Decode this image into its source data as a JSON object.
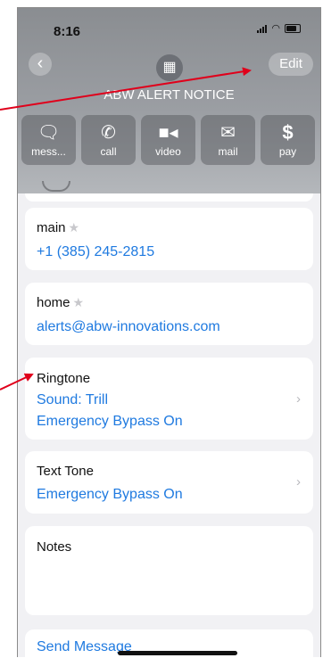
{
  "status_bar": {
    "time": "8:16"
  },
  "header": {
    "back_icon": "chevron-left-icon",
    "edit_label": "Edit",
    "contact_name": "ABW ALERT NOTICE",
    "avatar_icon": "building-icon",
    "actions": [
      {
        "label": "mess...",
        "icon": "message-bubble-icon"
      },
      {
        "label": "call",
        "icon": "phone-icon"
      },
      {
        "label": "video",
        "icon": "video-camera-icon"
      },
      {
        "label": "mail",
        "icon": "envelope-icon"
      },
      {
        "label": "pay",
        "icon": "dollar-icon"
      }
    ]
  },
  "fields": {
    "phone": {
      "label": "main",
      "value": "+1 (385) 245-2815"
    },
    "email": {
      "label": "home",
      "value": "alerts@abw-innovations.com"
    },
    "ringtone": {
      "label": "Ringtone",
      "sound": "Sound: Trill",
      "bypass": "Emergency Bypass On"
    },
    "text_tone": {
      "label": "Text Tone",
      "bypass": "Emergency Bypass On"
    },
    "notes": {
      "label": "Notes"
    },
    "send_message": "Send Message"
  },
  "annotation_color": "#e0001b"
}
